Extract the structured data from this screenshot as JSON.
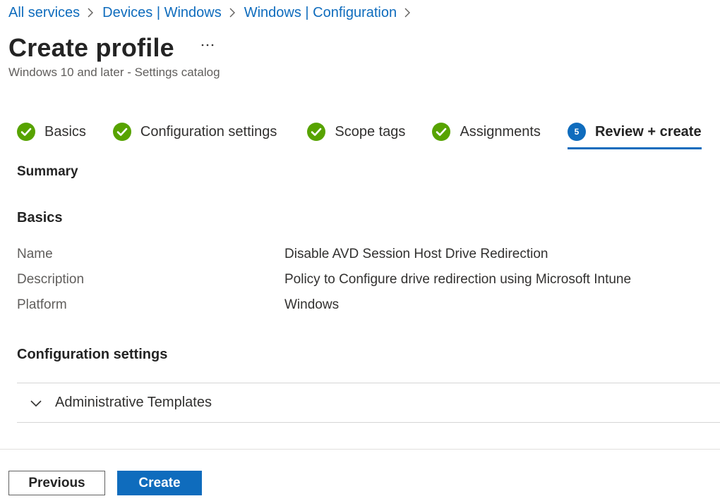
{
  "breadcrumb": [
    {
      "label": "All services"
    },
    {
      "label": "Devices | Windows"
    },
    {
      "label": "Windows | Configuration"
    }
  ],
  "header": {
    "title": "Create profile",
    "more_icon": "ellipsis-icon",
    "subtitle": "Windows 10 and later - Settings catalog"
  },
  "steps": [
    {
      "label": "Basics",
      "state": "complete"
    },
    {
      "label": "Configuration settings",
      "state": "complete"
    },
    {
      "label": "Scope tags",
      "state": "complete"
    },
    {
      "label": "Assignments",
      "state": "complete"
    },
    {
      "label": "Review + create",
      "number": "5",
      "state": "active"
    }
  ],
  "summary": {
    "heading": "Summary",
    "basics_heading": "Basics",
    "basics": [
      {
        "key": "Name",
        "value": "Disable AVD Session Host Drive Redirection"
      },
      {
        "key": "Description",
        "value": "Policy to Configure drive redirection using Microsoft Intune"
      },
      {
        "key": "Platform",
        "value": "Windows"
      }
    ],
    "config_heading": "Configuration settings",
    "config_group": "Administrative Templates"
  },
  "footer": {
    "previous_label": "Previous",
    "create_label": "Create"
  },
  "colors": {
    "accent": "#0f6cbd",
    "success": "#57a300",
    "text": "#323130",
    "muted": "#605e5c"
  }
}
